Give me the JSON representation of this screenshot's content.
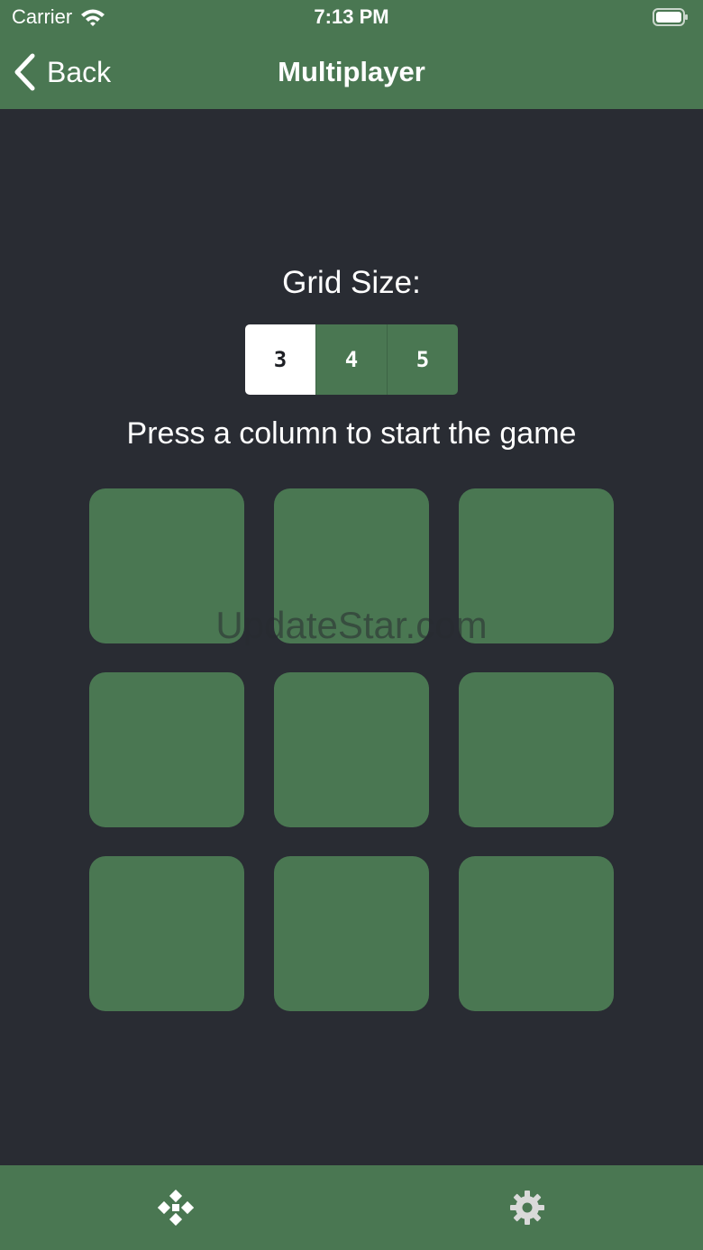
{
  "status_bar": {
    "carrier": "Carrier",
    "time": "7:13 PM",
    "wifi_icon": "wifi-icon",
    "battery_icon": "battery-icon"
  },
  "nav": {
    "back_label": "Back",
    "back_icon": "chevron-left-icon",
    "title": "Multiplayer"
  },
  "grid_size": {
    "label": "Grid Size:",
    "options": [
      "3",
      "4",
      "5"
    ],
    "selected": "3"
  },
  "instruction": "Press a column to start the game",
  "board": {
    "rows": 3,
    "columns": 3
  },
  "watermark": "UpdateStar.com",
  "tab_bar": {
    "items": [
      {
        "icon": "gamepad-icon"
      },
      {
        "icon": "gear-icon"
      }
    ]
  },
  "colors": {
    "accent": "#4a7752",
    "background": "#292c33",
    "selected_segment": "#ffffff",
    "text": "#ffffff"
  }
}
